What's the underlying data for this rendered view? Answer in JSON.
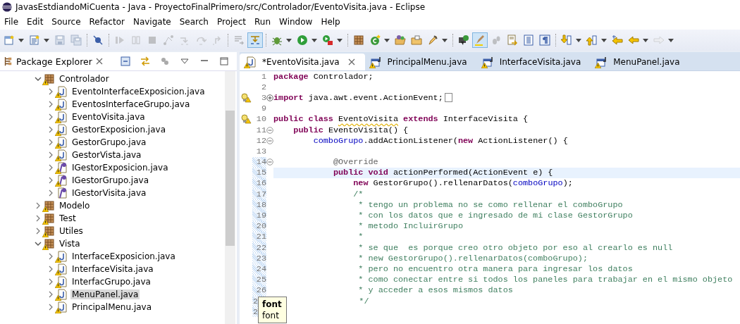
{
  "window": {
    "title": "JavasEstdiandoMiCuenta - Java - ProyectoFinalPrimero/src/Controlador/EventoVisita.java - Eclipse"
  },
  "menu": [
    "File",
    "Edit",
    "Source",
    "Refactor",
    "Navigate",
    "Search",
    "Project",
    "Run",
    "Window",
    "Help"
  ],
  "toolbar": [
    [
      {
        "kind": "new",
        "dropdown": true
      },
      {
        "kind": "new-type",
        "dropdown": true
      },
      {
        "kind": "save",
        "disabled": true
      },
      {
        "kind": "save-all",
        "disabled": true
      }
    ],
    [
      {
        "kind": "skip-breakpoints"
      }
    ],
    [
      {
        "kind": "resume",
        "disabled": true
      },
      {
        "kind": "suspend",
        "disabled": true
      },
      {
        "kind": "terminate",
        "disabled": true
      },
      {
        "kind": "disconnect",
        "disabled": true
      },
      {
        "kind": "step-into",
        "disabled": true
      },
      {
        "kind": "step-over",
        "disabled": true
      },
      {
        "kind": "step-return",
        "disabled": true
      }
    ],
    [
      {
        "kind": "use-filters",
        "disabled": true
      },
      {
        "kind": "drop-frame",
        "pressed": true
      }
    ],
    [
      {
        "kind": "debug",
        "dropdown": true
      },
      {
        "kind": "run",
        "dropdown": true
      },
      {
        "kind": "external",
        "dropdown": true
      }
    ],
    [
      {
        "kind": "new-package"
      },
      {
        "kind": "new-class",
        "dropdown": true
      },
      {
        "kind": "open-type"
      },
      {
        "kind": "open-folder"
      },
      {
        "kind": "search",
        "dropdown": true
      }
    ],
    [
      {
        "kind": "console"
      },
      {
        "kind": "highlight",
        "pressed": true
      },
      {
        "kind": "footprints",
        "disabled": true
      },
      {
        "kind": "doc-arrow"
      },
      {
        "kind": "list"
      },
      {
        "kind": "pilcrow"
      }
    ],
    [
      {
        "kind": "next",
        "dropdown": true
      },
      {
        "kind": "prev",
        "dropdown": true
      },
      {
        "kind": "last-edit"
      },
      {
        "kind": "back",
        "dropdown": true
      },
      {
        "kind": "forward",
        "dropdown": true,
        "disabled": true
      }
    ]
  ],
  "package_explorer": {
    "title": "Package Explorer",
    "tree": [
      {
        "label": "Controlador",
        "kind": "package",
        "warning": true,
        "expanded": true,
        "selected": false,
        "children": [
          {
            "label": "EventoInterfaceExposicion.java",
            "kind": "class",
            "warning": true,
            "expanded": false,
            "selected": false
          },
          {
            "label": "EventosInterfaceGrupo.java",
            "kind": "class",
            "warning": true,
            "expanded": false,
            "selected": false
          },
          {
            "label": "EventoVisita.java",
            "kind": "class",
            "warning": true,
            "expanded": false,
            "selected": false
          },
          {
            "label": "GestorExposicion.java",
            "kind": "class",
            "warning": true,
            "expanded": false,
            "selected": false
          },
          {
            "label": "GestorGrupo.java",
            "kind": "class",
            "warning": true,
            "expanded": false,
            "selected": false
          },
          {
            "label": "GestorVista.java",
            "kind": "class",
            "warning": true,
            "expanded": false,
            "selected": false
          },
          {
            "label": "IGestorExposicion.java",
            "kind": "interface",
            "warning": true,
            "expanded": false,
            "selected": false
          },
          {
            "label": "IGestorGrupo.java",
            "kind": "interface",
            "warning": true,
            "expanded": false,
            "selected": false
          },
          {
            "label": "IGestorVisita.java",
            "kind": "interface",
            "warning": false,
            "expanded": false,
            "selected": false
          }
        ]
      },
      {
        "label": "Modelo",
        "kind": "package",
        "warning": true,
        "expanded": false,
        "selected": false
      },
      {
        "label": "Test",
        "kind": "package",
        "warning": true,
        "expanded": false,
        "selected": false
      },
      {
        "label": "Utiles",
        "kind": "package",
        "warning": true,
        "expanded": false,
        "selected": false
      },
      {
        "label": "Vista",
        "kind": "package",
        "warning": true,
        "expanded": true,
        "selected": false,
        "children": [
          {
            "label": "InterfaceExposicion.java",
            "kind": "class",
            "warning": true,
            "expanded": false,
            "selected": false
          },
          {
            "label": "InterfaceVisita.java",
            "kind": "class",
            "warning": true,
            "expanded": false,
            "selected": false
          },
          {
            "label": "InterfacGrupo.java",
            "kind": "class",
            "warning": true,
            "expanded": false,
            "selected": false
          },
          {
            "label": "MenuPanel.java",
            "kind": "class",
            "warning": true,
            "expanded": false,
            "selected": true
          },
          {
            "label": "PrincipalMenu.java",
            "kind": "class",
            "warning": true,
            "expanded": false,
            "selected": false
          }
        ]
      }
    ]
  },
  "editor": {
    "tabs": [
      {
        "label": "*EventoVisita.java",
        "kind": "class",
        "warning": true,
        "selected": true
      },
      {
        "label": "PrincipalMenu.java",
        "kind": "form",
        "warning": true,
        "selected": false
      },
      {
        "label": "InterfaceVisita.java",
        "kind": "form",
        "warning": true,
        "selected": false
      },
      {
        "label": "MenuPanel.java",
        "kind": "form",
        "warning": true,
        "selected": false
      }
    ],
    "lines": [
      {
        "num": "1",
        "code": [
          {
            "kind": "keyword",
            "t": "package"
          },
          {
            "kind": "plain",
            "t": " Controlador;"
          }
        ]
      },
      {
        "num": "2"
      },
      {
        "num": "3",
        "quickfix": true,
        "fold": true,
        "collapsed": true,
        "code": [
          {
            "kind": "keyword",
            "t": "import"
          },
          {
            "kind": "plain",
            "t": " java.awt.event.ActionEvent;"
          }
        ]
      },
      {
        "num": "9"
      },
      {
        "num": "10",
        "quickfix": true,
        "code": [
          {
            "kind": "keyword",
            "t": "public class "
          },
          {
            "kind": "warn",
            "t": "EventoVisita"
          },
          {
            "kind": "keyword",
            "t": " extends"
          },
          {
            "kind": "plain",
            "t": " InterfaceVisita {"
          }
        ]
      },
      {
        "num": "11",
        "fold": true,
        "collapsed": false,
        "code": [
          {
            "kind": "keyword",
            "t": "    public"
          },
          {
            "kind": "plain",
            "t": " EventoVisita() {"
          }
        ]
      },
      {
        "num": "12",
        "fold": true,
        "collapsed": false,
        "code": [
          {
            "kind": "field",
            "t": "        comboGrupo"
          },
          {
            "kind": "plain",
            "t": ".addActionListener("
          },
          {
            "kind": "keyword",
            "t": "new"
          },
          {
            "kind": "plain",
            "t": " ActionListener() {"
          }
        ]
      },
      {
        "num": "13"
      },
      {
        "num": "14",
        "fold": true,
        "collapsed": false,
        "changed": true,
        "code": [
          {
            "kind": "annotation",
            "t": "            @Override"
          }
        ]
      },
      {
        "num": "15",
        "changed": true,
        "current": true,
        "code": [
          {
            "kind": "keyword",
            "t": "            public void"
          },
          {
            "kind": "plain",
            "t": " actionPerformed(ActionEvent e) {"
          }
        ]
      },
      {
        "num": "16",
        "changed": true,
        "code": [
          {
            "kind": "keyword",
            "t": "                new"
          },
          {
            "kind": "plain",
            "t": " GestorGrupo().rellenarDatos("
          },
          {
            "kind": "field",
            "t": "comboGrupo"
          },
          {
            "kind": "plain",
            "t": ");"
          }
        ]
      },
      {
        "num": "17",
        "changed": true,
        "code": [
          {
            "kind": "comment",
            "t": "                /*"
          }
        ]
      },
      {
        "num": "18",
        "changed": true,
        "code": [
          {
            "kind": "comment",
            "t": "                 * tengo un problema no se como rellenar el comboGrupo"
          }
        ]
      },
      {
        "num": "19",
        "changed": true,
        "code": [
          {
            "kind": "comment",
            "t": "                 * con los datos que e ingresado de mi clase GestorGrupo"
          }
        ]
      },
      {
        "num": "20",
        "changed": true,
        "code": [
          {
            "kind": "comment",
            "t": "                 * metodo IncluirGrupo"
          }
        ]
      },
      {
        "num": "21",
        "changed": true,
        "code": [
          {
            "kind": "comment",
            "t": "                 *"
          }
        ]
      },
      {
        "num": "22",
        "changed": true,
        "code": [
          {
            "kind": "comment",
            "t": "                 * se que  es porque creo otro objeto por eso al crearlo es null"
          }
        ]
      },
      {
        "num": "23",
        "changed": true,
        "code": [
          {
            "kind": "comment",
            "t": "                 * new GestorGrupo().rellenarDatos(comboGrupo);"
          }
        ]
      },
      {
        "num": "24",
        "changed": true,
        "code": [
          {
            "kind": "comment",
            "t": "                 * pero no encuentro otra manera para ingresar los datos"
          }
        ]
      },
      {
        "num": "25",
        "changed": true,
        "code": [
          {
            "kind": "comment",
            "t": "                 * como conectar entre si todos los paneles para trabajar en el mismo objeto"
          }
        ]
      },
      {
        "num": "26",
        "changed": true,
        "code": [
          {
            "kind": "comment",
            "t": "                 * y acceder a esos mismos datos"
          }
        ]
      },
      {
        "num": "2",
        "changed": true,
        "covered": true,
        "code": [
          {
            "kind": "comment",
            "t": "                 */"
          }
        ]
      },
      {
        "num": "2",
        "changed": true,
        "covered": true
      }
    ],
    "tooltip": {
      "title": "font",
      "text": "font"
    }
  }
}
